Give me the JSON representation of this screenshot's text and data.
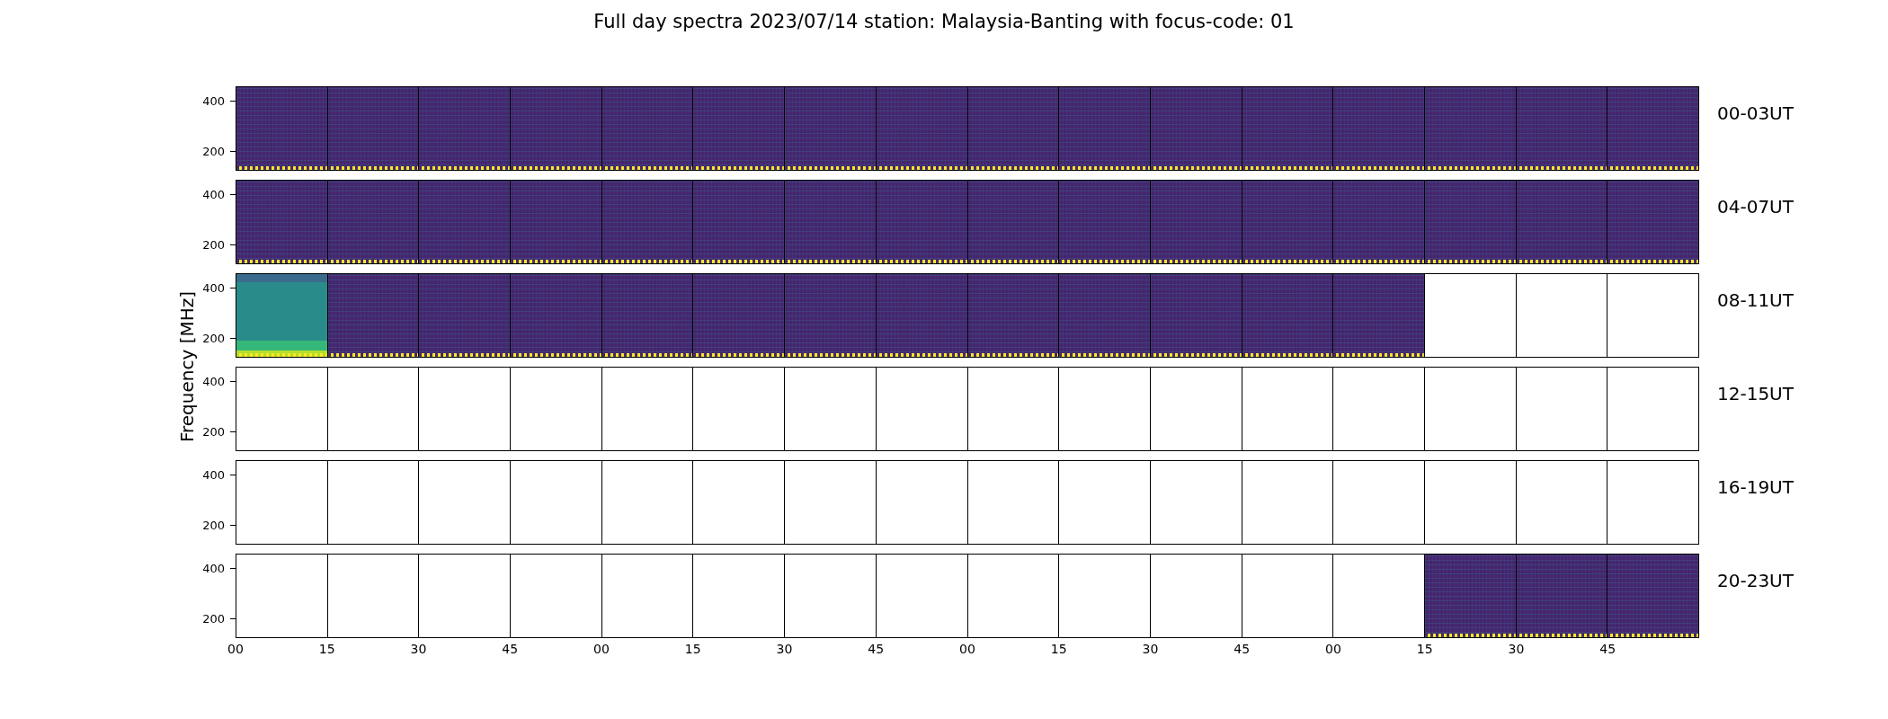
{
  "title": "Full day spectra 2023/07/14 station: Malaysia-Banting with focus-code: 01",
  "ylabel": "Frequency [MHz]",
  "rows": [
    {
      "label": "00-03UT",
      "yticks": [
        "400",
        "200"
      ],
      "panels": [
        {
          "kind": "spectrum"
        },
        {
          "kind": "spectrum"
        },
        {
          "kind": "spectrum"
        },
        {
          "kind": "spectrum"
        },
        {
          "kind": "spectrum"
        },
        {
          "kind": "spectrum"
        },
        {
          "kind": "spectrum"
        },
        {
          "kind": "spectrum"
        },
        {
          "kind": "spectrum"
        },
        {
          "kind": "spectrum"
        },
        {
          "kind": "spectrum"
        },
        {
          "kind": "spectrum"
        },
        {
          "kind": "spectrum"
        },
        {
          "kind": "spectrum"
        },
        {
          "kind": "spectrum"
        },
        {
          "kind": "spectrum"
        }
      ]
    },
    {
      "label": "04-07UT",
      "yticks": [
        "400",
        "200"
      ],
      "panels": [
        {
          "kind": "spectrum"
        },
        {
          "kind": "spectrum"
        },
        {
          "kind": "spectrum"
        },
        {
          "kind": "spectrum"
        },
        {
          "kind": "spectrum"
        },
        {
          "kind": "spectrum"
        },
        {
          "kind": "spectrum"
        },
        {
          "kind": "spectrum"
        },
        {
          "kind": "spectrum"
        },
        {
          "kind": "spectrum"
        },
        {
          "kind": "spectrum"
        },
        {
          "kind": "spectrum"
        },
        {
          "kind": "spectrum"
        },
        {
          "kind": "spectrum"
        },
        {
          "kind": "spectrum"
        },
        {
          "kind": "spectrum"
        }
      ]
    },
    {
      "label": "08-11UT",
      "yticks": [
        "400",
        "200"
      ],
      "panels": [
        {
          "kind": "bright"
        },
        {
          "kind": "spectrum"
        },
        {
          "kind": "spectrum"
        },
        {
          "kind": "spectrum"
        },
        {
          "kind": "spectrum"
        },
        {
          "kind": "spectrum"
        },
        {
          "kind": "spectrum"
        },
        {
          "kind": "spectrum"
        },
        {
          "kind": "spectrum"
        },
        {
          "kind": "spectrum"
        },
        {
          "kind": "spectrum"
        },
        {
          "kind": "spectrum"
        },
        {
          "kind": "spectrum"
        },
        {
          "kind": "empty"
        },
        {
          "kind": "empty"
        },
        {
          "kind": "empty"
        }
      ]
    },
    {
      "label": "12-15UT",
      "yticks": [
        "400",
        "200"
      ],
      "panels": [
        {
          "kind": "empty"
        },
        {
          "kind": "empty"
        },
        {
          "kind": "empty"
        },
        {
          "kind": "empty"
        },
        {
          "kind": "empty"
        },
        {
          "kind": "empty"
        },
        {
          "kind": "empty"
        },
        {
          "kind": "empty"
        },
        {
          "kind": "empty"
        },
        {
          "kind": "empty"
        },
        {
          "kind": "empty"
        },
        {
          "kind": "empty"
        },
        {
          "kind": "empty"
        },
        {
          "kind": "empty"
        },
        {
          "kind": "empty"
        },
        {
          "kind": "empty"
        }
      ]
    },
    {
      "label": "16-19UT",
      "yticks": [
        "400",
        "200"
      ],
      "panels": [
        {
          "kind": "empty"
        },
        {
          "kind": "empty"
        },
        {
          "kind": "empty"
        },
        {
          "kind": "empty"
        },
        {
          "kind": "empty"
        },
        {
          "kind": "empty"
        },
        {
          "kind": "empty"
        },
        {
          "kind": "empty"
        },
        {
          "kind": "empty"
        },
        {
          "kind": "empty"
        },
        {
          "kind": "empty"
        },
        {
          "kind": "empty"
        },
        {
          "kind": "empty"
        },
        {
          "kind": "empty"
        },
        {
          "kind": "empty"
        },
        {
          "kind": "empty"
        }
      ]
    },
    {
      "label": "20-23UT",
      "yticks": [
        "400",
        "200"
      ],
      "panels": [
        {
          "kind": "empty"
        },
        {
          "kind": "empty"
        },
        {
          "kind": "empty"
        },
        {
          "kind": "empty"
        },
        {
          "kind": "empty"
        },
        {
          "kind": "empty"
        },
        {
          "kind": "empty"
        },
        {
          "kind": "empty"
        },
        {
          "kind": "empty"
        },
        {
          "kind": "empty"
        },
        {
          "kind": "empty"
        },
        {
          "kind": "empty"
        },
        {
          "kind": "empty"
        },
        {
          "kind": "spectrum"
        },
        {
          "kind": "spectrum"
        },
        {
          "kind": "spectrum"
        }
      ]
    }
  ],
  "xticks": [
    "00",
    "15",
    "30",
    "45",
    "00",
    "15",
    "30",
    "45",
    "00",
    "15",
    "30",
    "45",
    "00",
    "15",
    "30",
    "45"
  ]
}
